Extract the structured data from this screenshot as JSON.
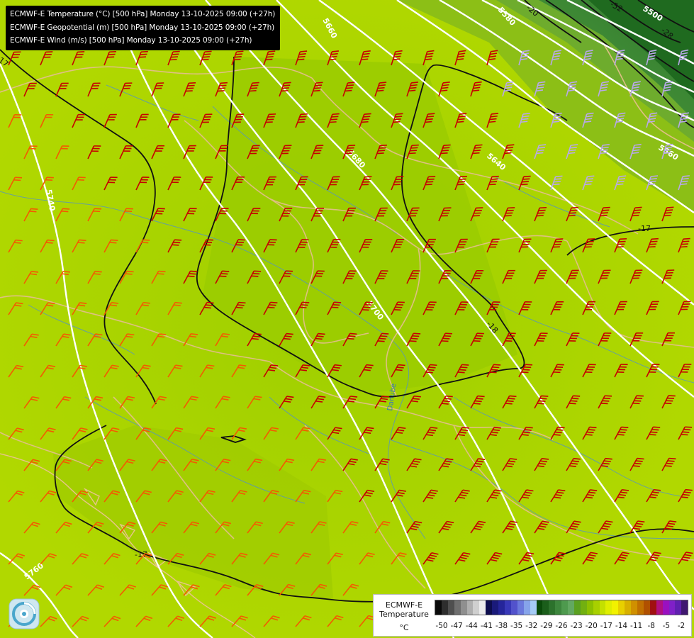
{
  "titles": [
    "ECMWF-E Temperature (°C) [500 hPa] Monday 13-10-2025 09:00 (+27h)",
    "ECMWF-E Geopotential (m) [500 hPa] Monday 13-10-2025 09:00 (+27h)",
    "ECMWF-E Wind (m/s) [500 hPa] Monday 13-10-2025 09:00 (+27h)"
  ],
  "legend": {
    "title": "ECMWF-E Temperature",
    "unit": "°C",
    "colors": [
      "#0a0a0a",
      "#2e2e2e",
      "#4f4f4f",
      "#6f6f6f",
      "#8f8f8f",
      "#afafaf",
      "#cfcfcf",
      "#ececec",
      "#0d0d4d",
      "#1a1a7a",
      "#25259a",
      "#3838b8",
      "#5252cc",
      "#6a78dc",
      "#86a4ea",
      "#a6ccf6",
      "#0a4a0a",
      "#1b5e1b",
      "#2c722c",
      "#3d863d",
      "#4e9a4e",
      "#62a862",
      "#5aa020",
      "#72b010",
      "#8cc000",
      "#a8d000",
      "#c4e000",
      "#dfee00",
      "#f2f200",
      "#e8d000",
      "#d8b000",
      "#d09000",
      "#c07000",
      "#b05000",
      "#a01010",
      "#b01080",
      "#9a10c0",
      "#8020c8",
      "#6020b0",
      "#401870"
    ],
    "ticks": [
      "-50",
      "-47",
      "-44",
      "-41",
      "-38",
      "-35",
      "-32",
      "-29",
      "-26",
      "-23",
      "-20",
      "-17",
      "-14",
      "-11",
      "-8",
      "-5",
      "-2"
    ]
  },
  "contour_labels": {
    "geopotential": [
      "5660",
      "5680",
      "5700",
      "5740",
      "5760",
      "5640",
      "5560",
      "5580",
      "5500"
    ],
    "temperature": [
      "-17",
      "-18",
      "-17",
      "-20",
      "-28",
      "-52",
      "-17"
    ]
  },
  "map_text": [
    "Danube"
  ],
  "colors": {
    "background": "#a6d000",
    "geopotential_line": "#ffffff",
    "temperature_line": "#111111",
    "coastline": "#e2bf8a",
    "river": "#4f8fcf",
    "barb_warm": "#f35a00",
    "barb_strong": "#c50000",
    "barb_cold": "#b8a8e8"
  },
  "logo": {
    "name": "meteologix-logo"
  }
}
